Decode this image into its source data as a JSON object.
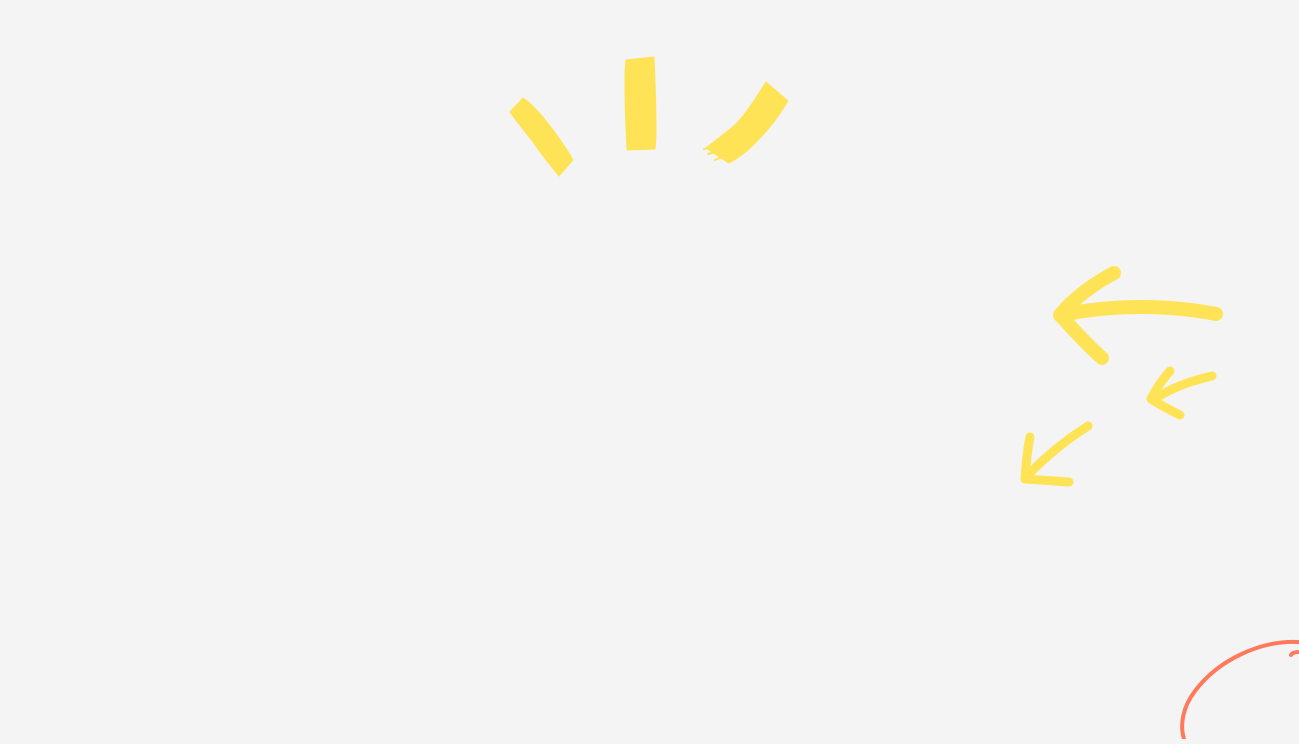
{
  "canvas": {
    "background_color": "#f4f4f4"
  },
  "decorations": {
    "accent_yellow": "#ffe356",
    "accent_coral": "#ff7a5c",
    "sparkle_marks": [
      "brush-stroke-left",
      "brush-stroke-center",
      "brush-stroke-right"
    ],
    "arrow_marks": [
      "large-curved-arrow",
      "small-arrow-right",
      "small-arrow-bottom-left"
    ],
    "circle_mark": "partial-coral-circle"
  }
}
